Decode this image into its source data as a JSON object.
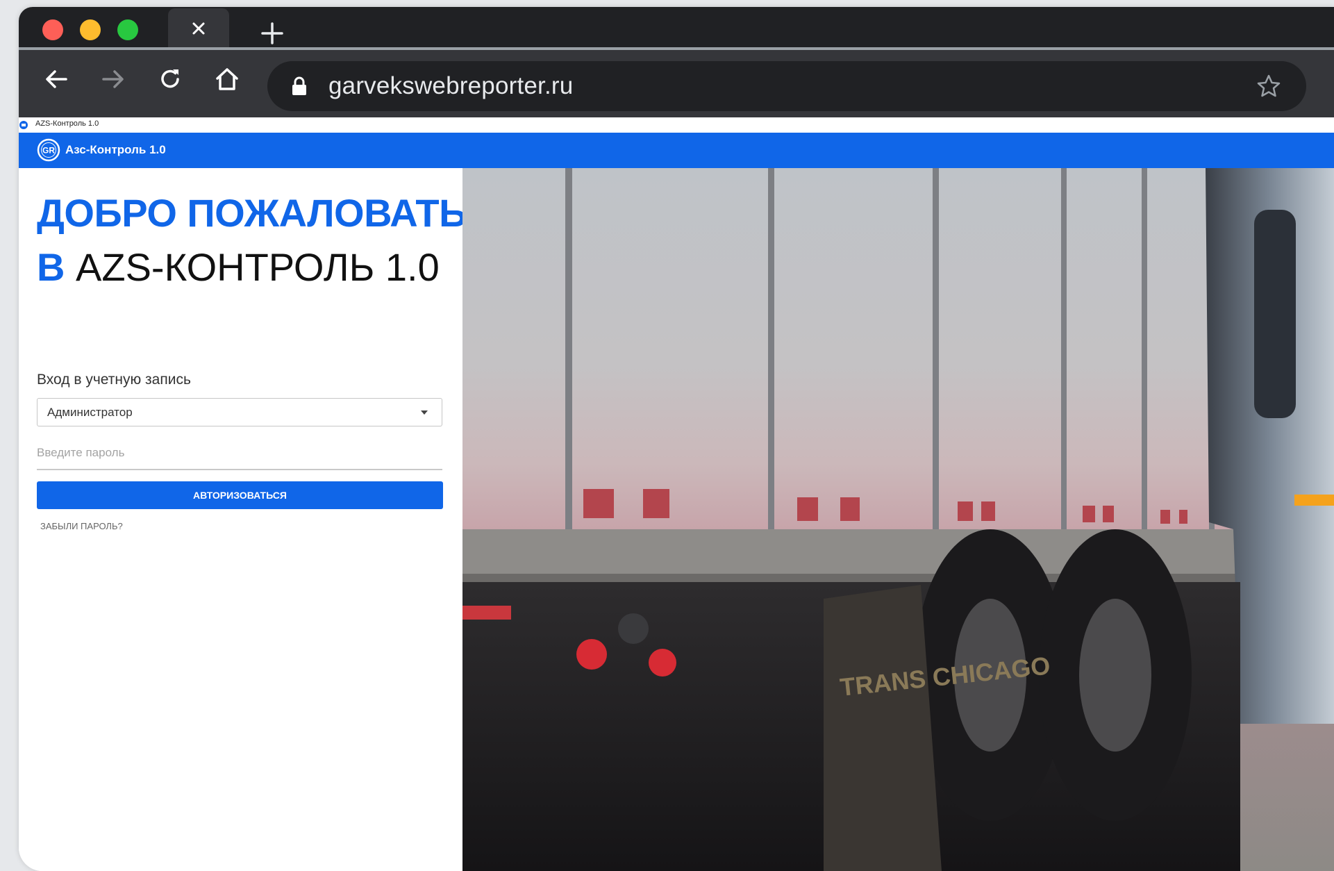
{
  "browser": {
    "url": "garvekswebreporter.ru"
  },
  "page": {
    "tab_title": "AZS-Контроль 1.0",
    "app_name": "Азс-Контроль 1.0",
    "logo_text": "GR",
    "welcome_line1": "ДОБРО ПОЖАЛОВАТЬ",
    "welcome_in": "В",
    "welcome_app": "AZS-КОНТРОЛЬ 1.0",
    "login_label": "Вход в учетную запись",
    "account_selected": "Администратор",
    "password_placeholder": "Введите пароль",
    "auth_button": "АВТОРИЗОВАТЬСЯ",
    "forgot_link": "ЗАБЫЛИ ПАРОЛЬ?",
    "truck_mudflap_text": "TRANS CHICAGO"
  },
  "colors": {
    "accent": "#1066e8",
    "chrome_dark": "#202124",
    "chrome_toolbar": "#35363a"
  }
}
